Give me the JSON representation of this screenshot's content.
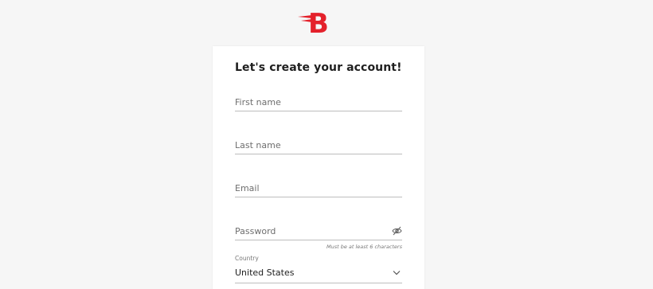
{
  "brand": {
    "logo_letter": "B",
    "brand_color": "#e4212b"
  },
  "signup": {
    "title": "Let's create your account!",
    "first_name_placeholder": "First name",
    "last_name_placeholder": "Last name",
    "email_placeholder": "Email",
    "password_placeholder": "Password",
    "password_hint": "Must be at least 6 characters",
    "password_visibility_icon": "eye-off-icon",
    "country_label": "Country",
    "country_value": "United States",
    "country_dropdown_icon": "chevron-down-icon"
  }
}
